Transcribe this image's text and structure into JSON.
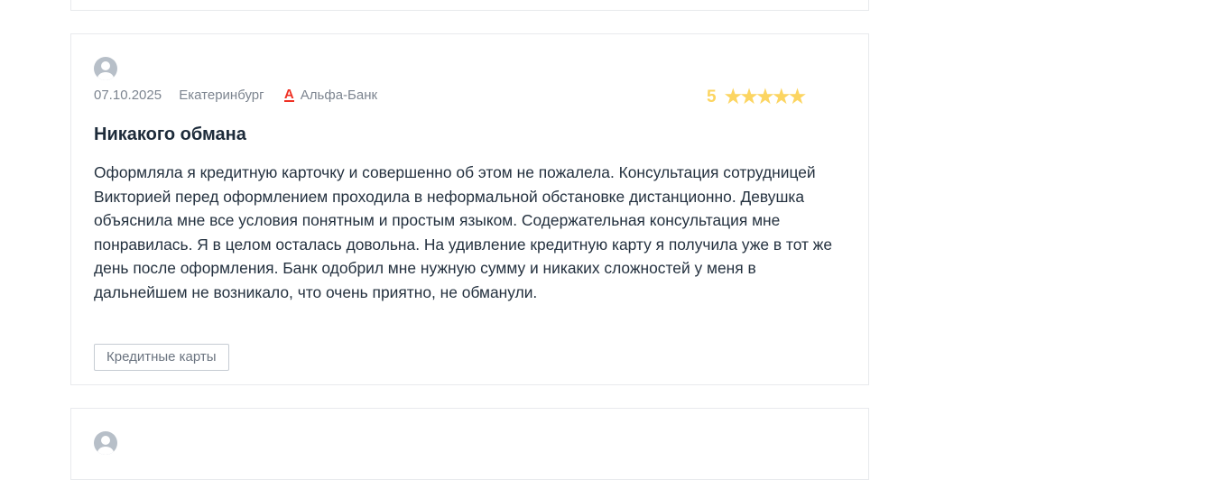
{
  "review": {
    "date": "07.10.2025",
    "city": "Екатеринбург",
    "bank_logo_letter": "А",
    "bank_name": "Альфа-Банк",
    "rating": "5",
    "stars": "★★★★★",
    "title": "Никакого обмана",
    "text": "Оформляла я кредитную карточку и совершенно об этом не пожалела. Консультация сотрудницей Викторией перед оформлением проходила в неформальной обстановке дистанционно. Девушка объяснила мне все условия понятным и простым языком. Содержательная консультация мне понравилась. Я в целом осталась довольна. На удивление кредитную карту я получила уже в тот же день после оформления. Банк одобрил мне нужную сумму и никаких сложностей у меня в дальнейшем не возникало, что очень приятно, не обманули.",
    "tag": "Кредитные карты"
  },
  "colors": {
    "star": "#fcd561",
    "bank_logo": "#ef3124",
    "avatar": "#b7bfc8"
  },
  "icons": {
    "avatar": "user-avatar-icon",
    "bank": "alfa-bank-logo-icon",
    "star": "star-icon"
  }
}
